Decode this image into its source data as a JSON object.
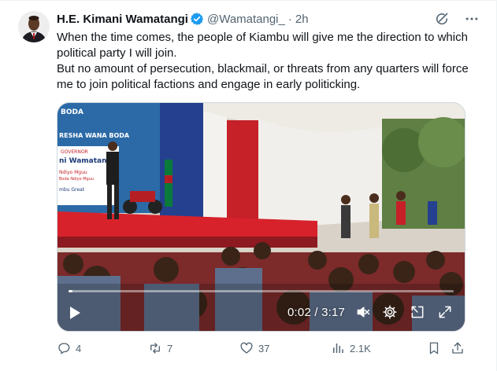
{
  "author": {
    "name": "H.E. Kimani Wamatangi",
    "handle": "@Wamatangi_",
    "separator": "·",
    "time": "2h"
  },
  "tweet": {
    "lines": [
      "When the time comes, the people of Kiambu will give me the direction to which political party I will join.",
      "But no amount of persecution, blackmail, or threats from any quarters will force me to join political factions and engage in early politicking."
    ]
  },
  "video": {
    "current_time": "0:02",
    "duration": "3:17",
    "time_display": "0:02 / 3:17",
    "progress_fraction": 0.01,
    "banner_lines": [
      "BODA",
      "RESHA WANA BODA",
      "GOVERNOR",
      "ni Wamatang",
      "Ndiyo Mguu",
      "Boda Ndiyo Mguu",
      "mbu Great"
    ]
  },
  "stats": {
    "replies": "4",
    "reposts": "7",
    "likes": "37",
    "views": "2.1K"
  },
  "colors": {
    "accent": "#1d9bf0",
    "muted": "#536471",
    "text": "#0f1419",
    "verified": "#1d9bf0"
  },
  "icons": {
    "grok": "grok-icon",
    "more": "more-icon",
    "reply": "reply-icon",
    "repost": "repost-icon",
    "like": "like-icon",
    "views": "views-icon",
    "bookmark": "bookmark-icon",
    "share": "share-icon"
  }
}
